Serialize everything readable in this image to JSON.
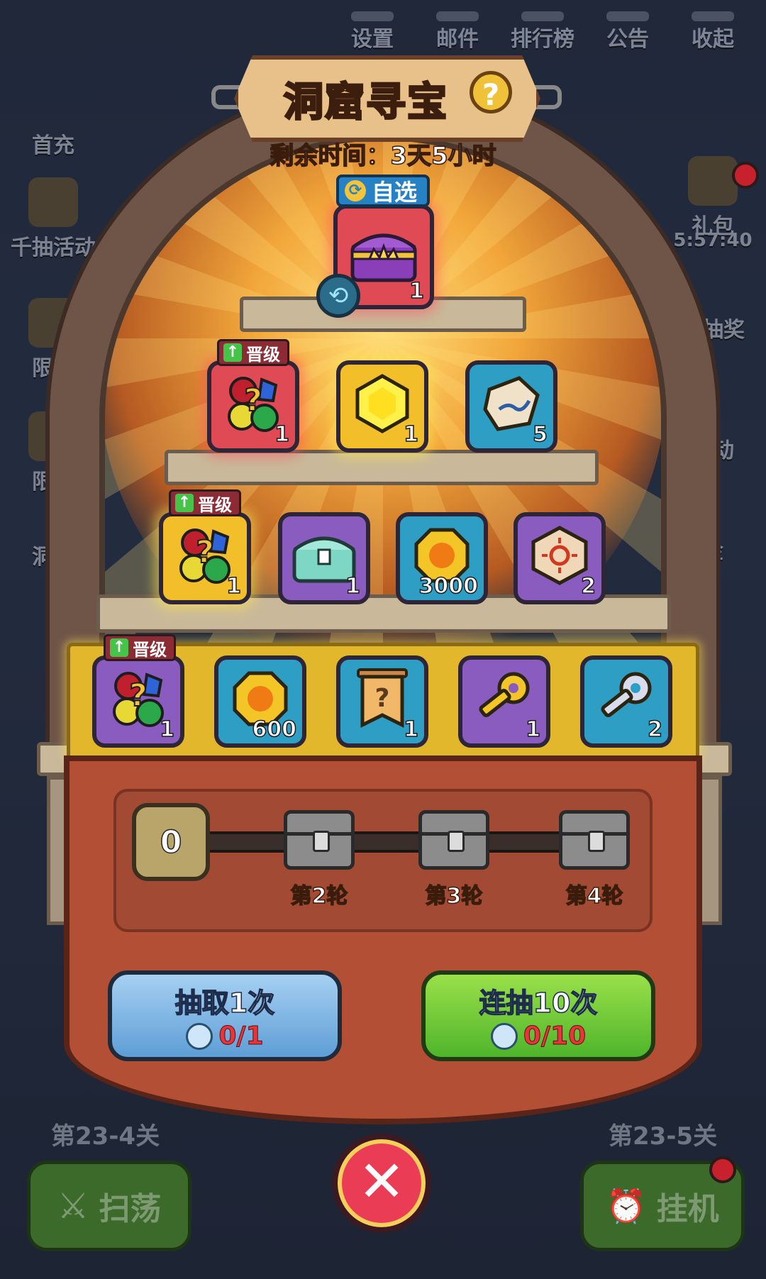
{
  "top_nav": [
    {
      "label": "设置",
      "icon": "gear-icon"
    },
    {
      "label": "邮件",
      "icon": "mail-icon"
    },
    {
      "label": "排行榜",
      "icon": "ranking-icon"
    },
    {
      "label": "公告",
      "icon": "announcement-icon"
    },
    {
      "label": "收起",
      "icon": "collapse-icon"
    }
  ],
  "left_side": [
    "首充",
    "千抽活动",
    "限时",
    "限时",
    "洞窟"
  ],
  "right_side": [
    "礼包",
    "5:57:40",
    "物抽奖",
    "活动",
    "金"
  ],
  "popup": {
    "title": "洞窟寻宝",
    "help": "?",
    "timer": "剩余时间：3天5小时",
    "select_tag": "自选",
    "upgrade_tag": "晋级",
    "tier0": [
      {
        "count": "1",
        "icon": "crown-chest-icon",
        "color": "red"
      }
    ],
    "tier1": [
      {
        "count": "1",
        "icon": "gem-pack-icon",
        "color": "red",
        "upgrade": true
      },
      {
        "count": "1",
        "icon": "yellow-gem-icon",
        "color": "gold"
      },
      {
        "count": "5",
        "icon": "rune-stone-icon",
        "color": "blue"
      }
    ],
    "tier2": [
      {
        "count": "1",
        "icon": "gem-pack-icon",
        "color": "gold",
        "upgrade": true
      },
      {
        "count": "1",
        "icon": "teal-chest-icon",
        "color": "purple"
      },
      {
        "count": "3000",
        "icon": "gold-coin-icon",
        "color": "blue"
      },
      {
        "count": "2",
        "icon": "sun-stone-icon",
        "color": "purple"
      }
    ],
    "tier3": [
      {
        "count": "1",
        "icon": "gem-pack-icon",
        "color": "purple",
        "upgrade": true
      },
      {
        "count": "600",
        "icon": "gold-coin-icon",
        "color": "blue"
      },
      {
        "count": "1",
        "icon": "mystery-banner-icon",
        "color": "blue"
      },
      {
        "count": "1",
        "icon": "gold-key-icon",
        "color": "purple"
      },
      {
        "count": "2",
        "icon": "silver-key-icon",
        "color": "blue"
      }
    ],
    "progress_value": "0",
    "milestones": [
      "第2轮",
      "第3轮",
      "第4轮"
    ],
    "draw_one": {
      "label": "抽取1次",
      "cost": "0/1"
    },
    "draw_ten": {
      "label": "连抽10次",
      "cost": "0/10"
    },
    "close": "✕"
  },
  "background": {
    "stage_left": "第23-4关",
    "stage_right": "第23-5关",
    "sweep_button": "扫荡",
    "idle_button": "挂机"
  }
}
